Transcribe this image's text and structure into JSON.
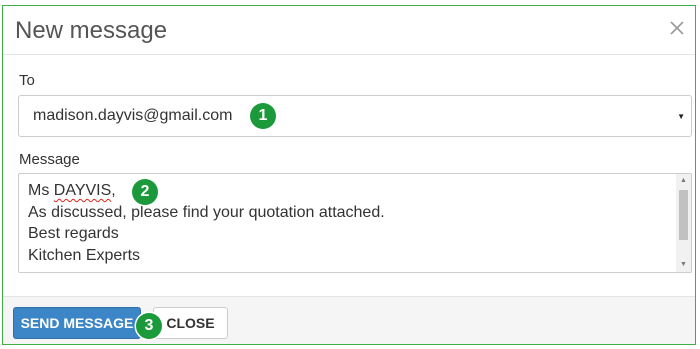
{
  "dialog": {
    "title": "New message",
    "close_icon": "close-icon"
  },
  "to": {
    "label": "To",
    "selected_value": "madison.dayvis@gmail.com",
    "caret_icon": "caret-down-icon"
  },
  "message": {
    "label": "Message",
    "lines": [
      "Ms DAYVIS,",
      "As discussed, please find your quotation attached.",
      "Best regards",
      "Kitchen Experts"
    ],
    "greeting_prefix": "Ms ",
    "greeting_misspelled": "DAYVIS",
    "greeting_suffix": ","
  },
  "footer": {
    "send_label": "SEND MESSAGE",
    "close_label": "CLOSE"
  },
  "annotations": {
    "step1": "1",
    "step2": "2",
    "step3": "3",
    "badge_color": "#1c9a3b"
  },
  "colors": {
    "border_accent": "#3fae49",
    "primary_button": "#3c85c6"
  }
}
